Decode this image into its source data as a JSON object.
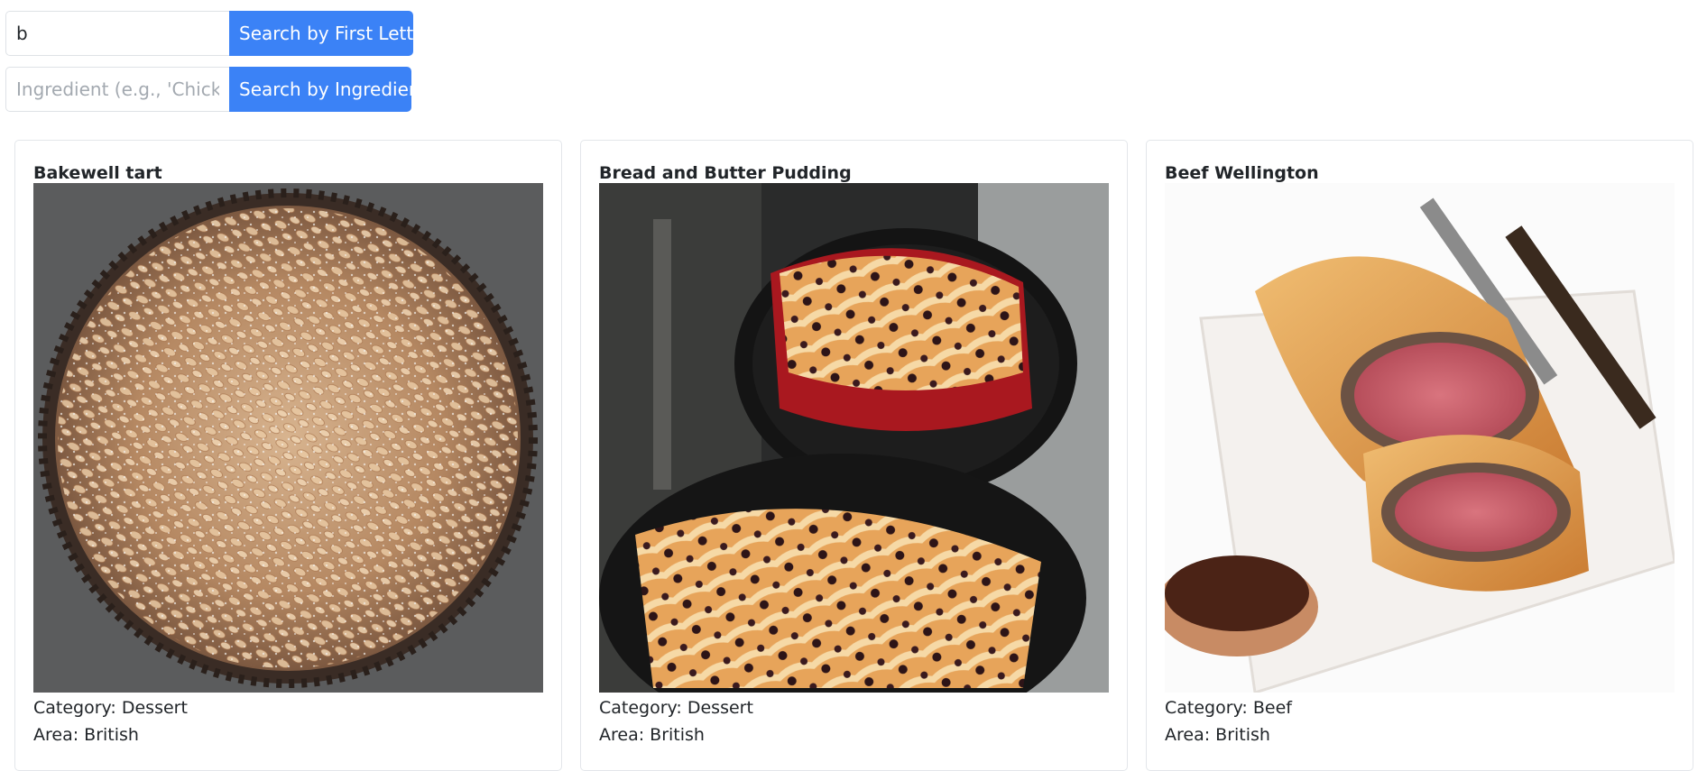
{
  "search": {
    "first_letter": {
      "value": "b",
      "button_label": "Search by First Letter"
    },
    "ingredient": {
      "value": "",
      "placeholder": "Ingredient (e.g., 'Chicken')",
      "button_label": "Search by Ingredient"
    }
  },
  "colors": {
    "accent": "#3b82f6",
    "border": "#dee2e6"
  },
  "meals": [
    {
      "name": "Bakewell tart",
      "image": "bakewell-tart-photo",
      "category_text": "Category: Dessert",
      "area_text": "Area: British"
    },
    {
      "name": "Bread and Butter Pudding",
      "image": "bread-and-butter-pudding-photo",
      "category_text": "Category: Dessert",
      "area_text": "Area: British"
    },
    {
      "name": "Beef Wellington",
      "image": "beef-wellington-photo",
      "category_text": "Category: Beef",
      "area_text": "Area: British"
    }
  ]
}
